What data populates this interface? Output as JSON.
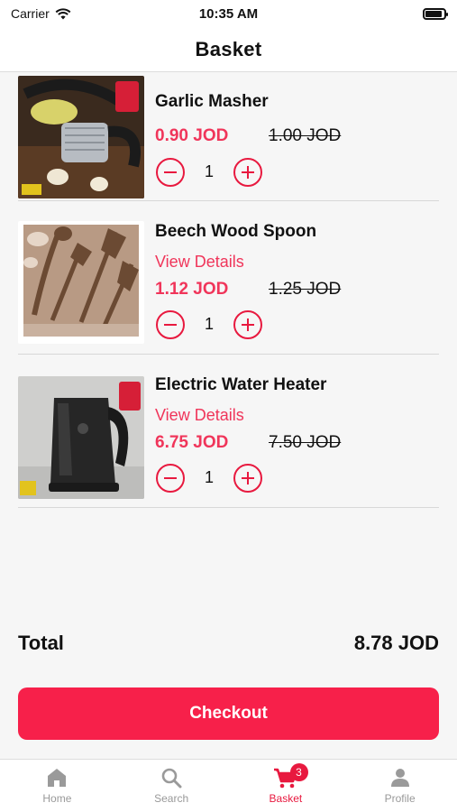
{
  "status_bar": {
    "carrier": "Carrier",
    "time": "10:35 AM"
  },
  "header": {
    "title": "Basket"
  },
  "items": [
    {
      "name": "Garlic Masher",
      "details_label": "",
      "price": "0.90 JOD",
      "old_price": "1.00 JOD",
      "quantity": "1"
    },
    {
      "name": "Beech Wood Spoon",
      "details_label": "View Details",
      "price": "1.12 JOD",
      "old_price": "1.25 JOD",
      "quantity": "1"
    },
    {
      "name": "Electric Water Heater",
      "details_label": "View Details",
      "price": "6.75 JOD",
      "old_price": "7.50 JOD",
      "quantity": "1"
    }
  ],
  "summary": {
    "total_label": "Total",
    "total_value": "8.78 JOD"
  },
  "checkout_label": "Checkout",
  "tabs": [
    {
      "label": "Home",
      "icon": "home-icon"
    },
    {
      "label": "Search",
      "icon": "search-icon"
    },
    {
      "label": "Basket",
      "icon": "cart-icon",
      "badge": "3"
    },
    {
      "label": "Profile",
      "icon": "person-icon"
    }
  ],
  "colors": {
    "accent": "#e8193f",
    "checkout": "#f7204a",
    "inactive_tab": "#999999"
  }
}
